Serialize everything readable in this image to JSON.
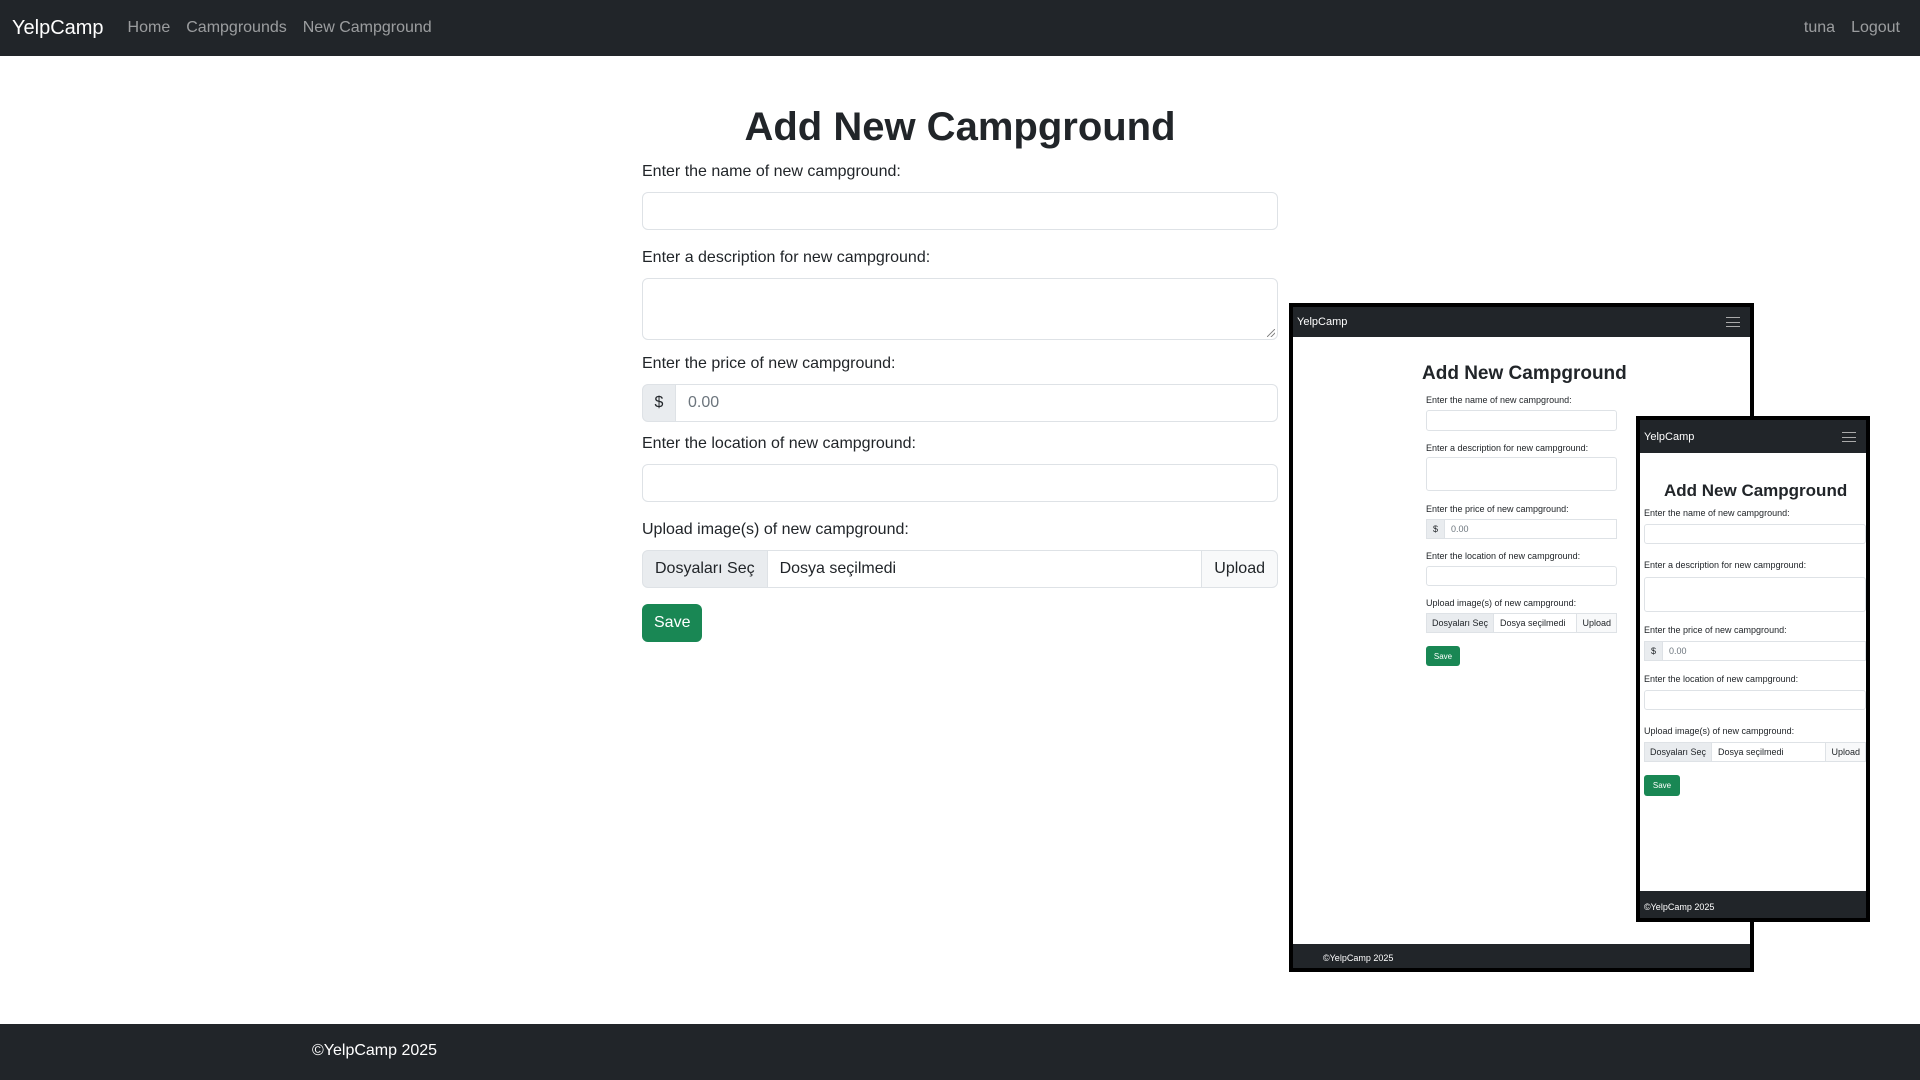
{
  "navbar": {
    "brand": "YelpCamp",
    "links": [
      "Home",
      "Campgrounds",
      "New Campground"
    ],
    "right_links": [
      "tuna",
      "Logout"
    ]
  },
  "form": {
    "title": "Add New Campground",
    "name_label": "Enter the name of new campground:",
    "description_label": "Enter a description for new campground:",
    "price_label": "Enter the price of new campground:",
    "price_prefix": "$",
    "price_placeholder": "0.00",
    "location_label": "Enter the location of new campground:",
    "upload_label": "Upload image(s) of new campground:",
    "choose_files": "Dosyaları Seç",
    "no_file": "Dosya seçilmedi",
    "upload_button": "Upload",
    "save_button": "Save"
  },
  "footer": {
    "text": "©YelpCamp 2025"
  },
  "preview_tablet": {
    "brand": "YelpCamp",
    "title": "Add New Campground",
    "name_label": "Enter the name of new campground:",
    "description_label": "Enter a description for new campground:",
    "price_label": "Enter the price of new campground:",
    "price_prefix": "$",
    "price_placeholder": "0.00",
    "location_label": "Enter the location of new campground:",
    "upload_label": "Upload image(s) of new campground:",
    "choose_files": "Dosyaları Seç",
    "no_file": "Dosya seçilmedi",
    "upload_button": "Upload",
    "save_button": "Save",
    "footer": "©YelpCamp 2025"
  },
  "preview_phone": {
    "brand": "YelpCamp",
    "title": "Add New Campground",
    "name_label": "Enter the name of new campground:",
    "description_label": "Enter a description for new campground:",
    "price_label": "Enter the price of new campground:",
    "price_prefix": "$",
    "price_placeholder": "0.00",
    "location_label": "Enter the location of new campground:",
    "upload_label": "Upload image(s) of new campground:",
    "choose_files": "Dosyaları Seç",
    "no_file": "Dosya seçilmedi",
    "upload_button": "Upload",
    "save_button": "Save",
    "footer": "©YelpCamp 2025"
  }
}
